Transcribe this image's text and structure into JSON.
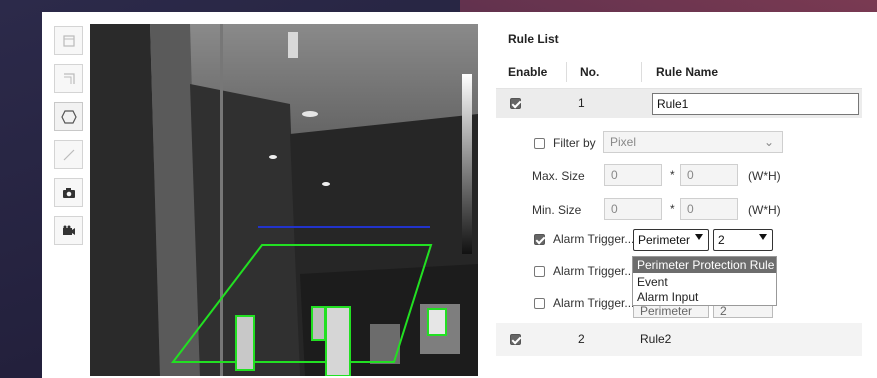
{
  "rule_list": {
    "title": "Rule List",
    "columns": {
      "enable": "Enable",
      "no": "No.",
      "rule_name": "Rule Name"
    },
    "rows": [
      {
        "enabled": true,
        "no": "1",
        "name": "Rule1"
      },
      {
        "enabled": true,
        "no": "2",
        "name": "Rule2"
      }
    ]
  },
  "rule_detail": {
    "filter_by_label": "Filter by",
    "filter_by_value": "Pixel",
    "max_size_label": "Max. Size",
    "max_w": "0",
    "max_h": "0",
    "min_size_label": "Min. Size",
    "min_w": "0",
    "min_h": "0",
    "times": "*",
    "unit": "(W*H)",
    "alarm_triggers": [
      {
        "label": "Alarm Trigger...",
        "checked": true,
        "type": "Perimeter",
        "value": "2"
      },
      {
        "label": "Alarm Trigger...",
        "checked": false
      },
      {
        "label": "Alarm Trigger...",
        "checked": false,
        "type": "Perimeter",
        "value": "2"
      }
    ]
  },
  "dropdown_options": [
    "Perimeter Protection Rule",
    "Event",
    "Alarm Input"
  ],
  "toolbar": {
    "icons": [
      "draw-rectangle-icon",
      "draw-corner-icon",
      "draw-polygon-icon",
      "draw-line-icon",
      "camera-icon",
      "video-camera-icon"
    ]
  },
  "colors": {
    "region": "#22e022",
    "line": "#2233cc",
    "highlight": "#6d6d6d"
  }
}
